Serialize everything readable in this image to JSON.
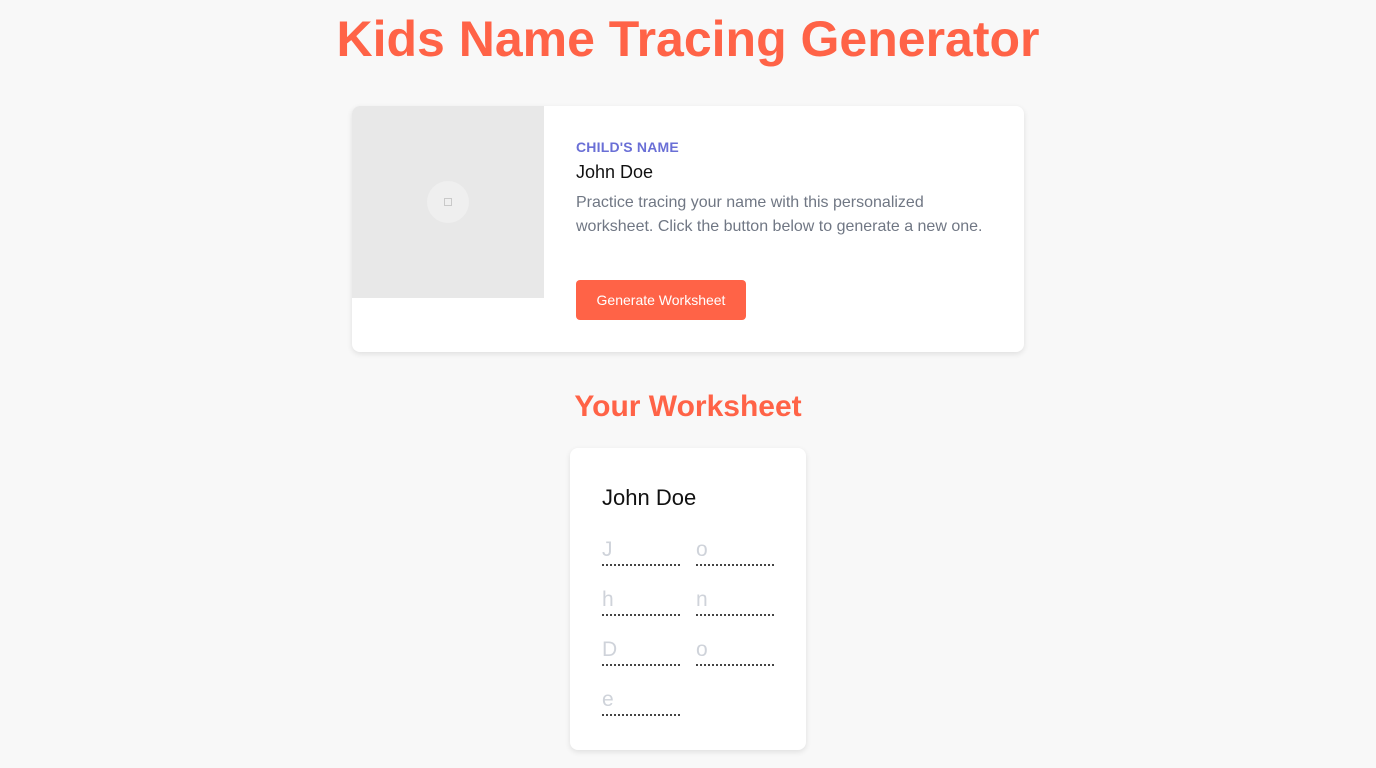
{
  "page": {
    "title": "Kids Name Tracing Generator"
  },
  "hero": {
    "image_icon": "image-placeholder-icon",
    "label": "CHILD'S NAME",
    "name": "John Doe",
    "description": "Practice tracing your name with this personalized worksheet. Click the button below to generate a new one.",
    "button_label": "Generate Worksheet"
  },
  "worksheet": {
    "section_title": "Your Worksheet",
    "name": "John Doe",
    "letters": [
      "J",
      "o",
      "h",
      "n",
      "D",
      "o",
      "e"
    ]
  },
  "colors": {
    "accent": "#ff6347",
    "label": "#6a6fd6",
    "background": "#f8f8f8",
    "trace_letter": "#cfd3da"
  }
}
